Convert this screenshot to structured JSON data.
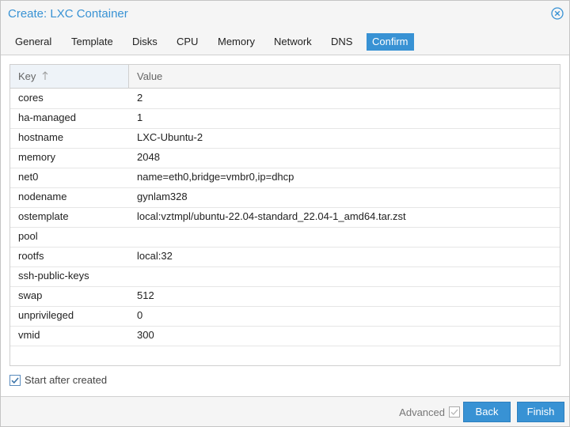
{
  "window": {
    "title": "Create: LXC Container"
  },
  "tabs": [
    {
      "label": "General"
    },
    {
      "label": "Template"
    },
    {
      "label": "Disks"
    },
    {
      "label": "CPU"
    },
    {
      "label": "Memory"
    },
    {
      "label": "Network"
    },
    {
      "label": "DNS"
    },
    {
      "label": "Confirm",
      "active": true
    }
  ],
  "grid": {
    "columns": {
      "key": "Key",
      "value": "Value"
    },
    "sort": "ascending",
    "rows": [
      {
        "key": "cores",
        "value": "2"
      },
      {
        "key": "ha-managed",
        "value": "1"
      },
      {
        "key": "hostname",
        "value": "LXC-Ubuntu-2"
      },
      {
        "key": "memory",
        "value": "2048"
      },
      {
        "key": "net0",
        "value": "name=eth0,bridge=vmbr0,ip=dhcp"
      },
      {
        "key": "nodename",
        "value": "gynlam328"
      },
      {
        "key": "ostemplate",
        "value": "local:vztmpl/ubuntu-22.04-standard_22.04-1_amd64.tar.zst"
      },
      {
        "key": "pool",
        "value": ""
      },
      {
        "key": "rootfs",
        "value": "local:32"
      },
      {
        "key": "ssh-public-keys",
        "value": ""
      },
      {
        "key": "swap",
        "value": "512"
      },
      {
        "key": "unprivileged",
        "value": "0"
      },
      {
        "key": "vmid",
        "value": "300"
      }
    ]
  },
  "start_after_created": {
    "label": "Start after created",
    "checked": true
  },
  "footer": {
    "advanced_label": "Advanced",
    "advanced_checked": false,
    "back_label": "Back",
    "finish_label": "Finish"
  },
  "colors": {
    "accent": "#3892d4"
  },
  "icons": {
    "close": "close-circle-icon",
    "sort": "sort-up-arrow-icon",
    "checkbox": "checkmark-icon"
  }
}
